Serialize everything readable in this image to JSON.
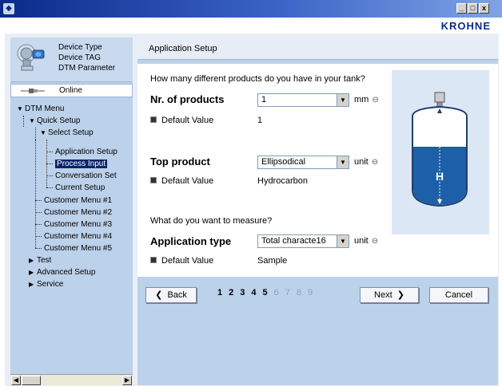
{
  "window": {
    "minimize": "_",
    "maximize": "□",
    "close": "x"
  },
  "brand": "KROHNE",
  "device": {
    "type": "Device Type",
    "tag": "Device TAG",
    "dtm": "DTM Parameter"
  },
  "status": "Online",
  "tree": {
    "dtm_menu": "DTM Menu",
    "quick_setup": "Quick Setup",
    "select_setup": "Select Setup",
    "application_setup": "Application Setup",
    "process_input": "Process Input",
    "conversation_set": "Conversation Set",
    "current_setup": "Current Setup",
    "customer_menus": [
      "Customer Menu #1",
      "Customer Menu #2",
      "Customer Menu #3",
      "Customer Menu #4",
      "Customer Menu #5"
    ],
    "test": "Test",
    "advanced_setup": "Advanced Setup",
    "service": "Service"
  },
  "main": {
    "title": "Application Setup",
    "q1": "How many different products do you have in your tank?",
    "products_label": "Nr. of products",
    "products_value": "1",
    "products_unit": "mm",
    "default_label": "Default Value",
    "products_default": "1",
    "top_product_label": "Top product",
    "top_product_value": "Ellipsodical",
    "top_product_unit": "unit",
    "top_product_default": "Hydrocarbon",
    "q2": "What do you want to measure?",
    "app_type_label": "Application type",
    "app_type_value": "Total characte16",
    "app_type_unit": "unit",
    "app_type_default": "Sample",
    "tank_label": "H"
  },
  "nav": {
    "back": "Back",
    "next": "Next",
    "cancel": "Cancel",
    "pages": [
      "1",
      "2",
      "3",
      "4",
      "5",
      "6",
      "7",
      "8",
      "9"
    ],
    "pages_active_count": 5
  },
  "colors": {
    "selection": "#0a246a",
    "panel": "#bcd1ea",
    "tank_fill": "#1d5fa8",
    "brand": "#0b2a8a"
  }
}
